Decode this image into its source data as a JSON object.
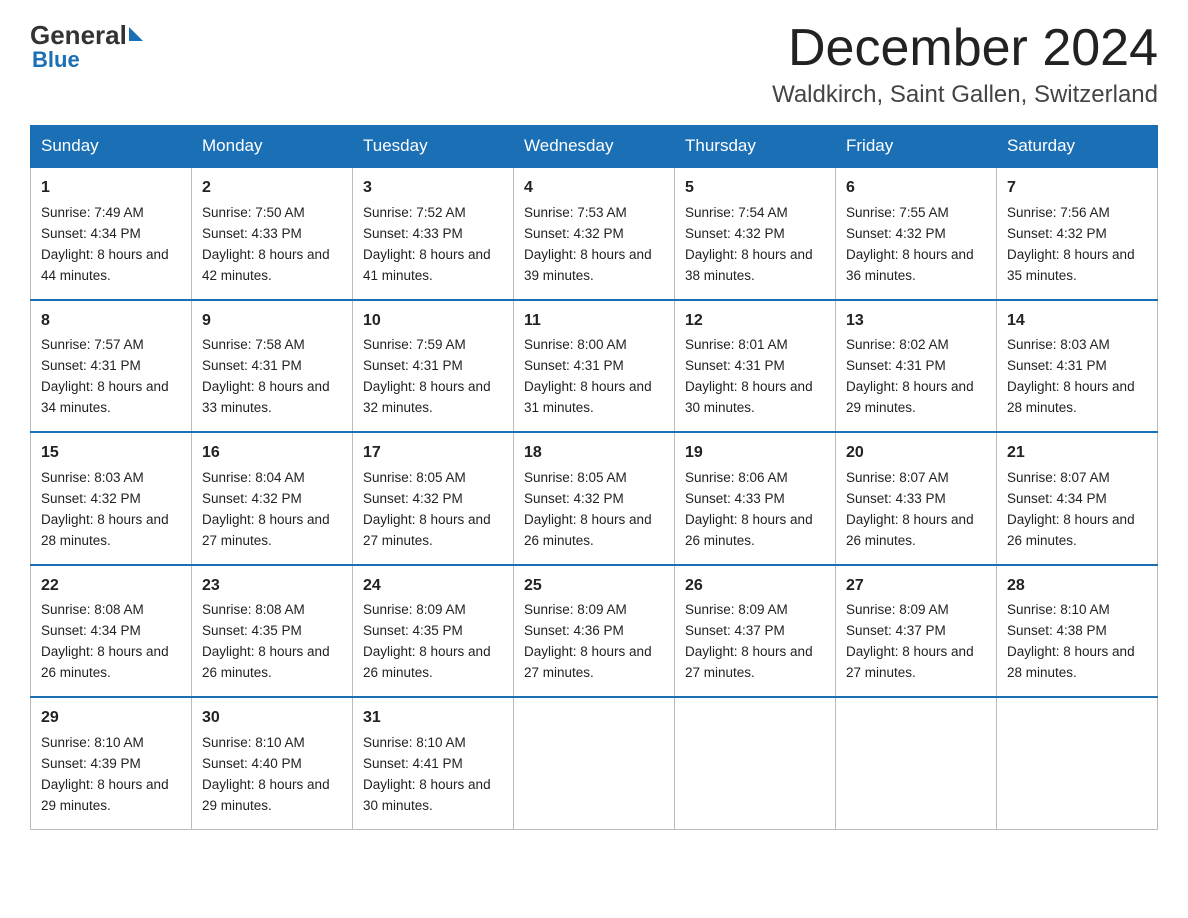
{
  "header": {
    "logo_general": "General",
    "logo_blue": "Blue",
    "month_title": "December 2024",
    "location": "Waldkirch, Saint Gallen, Switzerland"
  },
  "days_of_week": [
    "Sunday",
    "Monday",
    "Tuesday",
    "Wednesday",
    "Thursday",
    "Friday",
    "Saturday"
  ],
  "weeks": [
    [
      {
        "date": "1",
        "sunrise": "7:49 AM",
        "sunset": "4:34 PM",
        "daylight": "8 hours and 44 minutes."
      },
      {
        "date": "2",
        "sunrise": "7:50 AM",
        "sunset": "4:33 PM",
        "daylight": "8 hours and 42 minutes."
      },
      {
        "date": "3",
        "sunrise": "7:52 AM",
        "sunset": "4:33 PM",
        "daylight": "8 hours and 41 minutes."
      },
      {
        "date": "4",
        "sunrise": "7:53 AM",
        "sunset": "4:32 PM",
        "daylight": "8 hours and 39 minutes."
      },
      {
        "date": "5",
        "sunrise": "7:54 AM",
        "sunset": "4:32 PM",
        "daylight": "8 hours and 38 minutes."
      },
      {
        "date": "6",
        "sunrise": "7:55 AM",
        "sunset": "4:32 PM",
        "daylight": "8 hours and 36 minutes."
      },
      {
        "date": "7",
        "sunrise": "7:56 AM",
        "sunset": "4:32 PM",
        "daylight": "8 hours and 35 minutes."
      }
    ],
    [
      {
        "date": "8",
        "sunrise": "7:57 AM",
        "sunset": "4:31 PM",
        "daylight": "8 hours and 34 minutes."
      },
      {
        "date": "9",
        "sunrise": "7:58 AM",
        "sunset": "4:31 PM",
        "daylight": "8 hours and 33 minutes."
      },
      {
        "date": "10",
        "sunrise": "7:59 AM",
        "sunset": "4:31 PM",
        "daylight": "8 hours and 32 minutes."
      },
      {
        "date": "11",
        "sunrise": "8:00 AM",
        "sunset": "4:31 PM",
        "daylight": "8 hours and 31 minutes."
      },
      {
        "date": "12",
        "sunrise": "8:01 AM",
        "sunset": "4:31 PM",
        "daylight": "8 hours and 30 minutes."
      },
      {
        "date": "13",
        "sunrise": "8:02 AM",
        "sunset": "4:31 PM",
        "daylight": "8 hours and 29 minutes."
      },
      {
        "date": "14",
        "sunrise": "8:03 AM",
        "sunset": "4:31 PM",
        "daylight": "8 hours and 28 minutes."
      }
    ],
    [
      {
        "date": "15",
        "sunrise": "8:03 AM",
        "sunset": "4:32 PM",
        "daylight": "8 hours and 28 minutes."
      },
      {
        "date": "16",
        "sunrise": "8:04 AM",
        "sunset": "4:32 PM",
        "daylight": "8 hours and 27 minutes."
      },
      {
        "date": "17",
        "sunrise": "8:05 AM",
        "sunset": "4:32 PM",
        "daylight": "8 hours and 27 minutes."
      },
      {
        "date": "18",
        "sunrise": "8:05 AM",
        "sunset": "4:32 PM",
        "daylight": "8 hours and 26 minutes."
      },
      {
        "date": "19",
        "sunrise": "8:06 AM",
        "sunset": "4:33 PM",
        "daylight": "8 hours and 26 minutes."
      },
      {
        "date": "20",
        "sunrise": "8:07 AM",
        "sunset": "4:33 PM",
        "daylight": "8 hours and 26 minutes."
      },
      {
        "date": "21",
        "sunrise": "8:07 AM",
        "sunset": "4:34 PM",
        "daylight": "8 hours and 26 minutes."
      }
    ],
    [
      {
        "date": "22",
        "sunrise": "8:08 AM",
        "sunset": "4:34 PM",
        "daylight": "8 hours and 26 minutes."
      },
      {
        "date": "23",
        "sunrise": "8:08 AM",
        "sunset": "4:35 PM",
        "daylight": "8 hours and 26 minutes."
      },
      {
        "date": "24",
        "sunrise": "8:09 AM",
        "sunset": "4:35 PM",
        "daylight": "8 hours and 26 minutes."
      },
      {
        "date": "25",
        "sunrise": "8:09 AM",
        "sunset": "4:36 PM",
        "daylight": "8 hours and 27 minutes."
      },
      {
        "date": "26",
        "sunrise": "8:09 AM",
        "sunset": "4:37 PM",
        "daylight": "8 hours and 27 minutes."
      },
      {
        "date": "27",
        "sunrise": "8:09 AM",
        "sunset": "4:37 PM",
        "daylight": "8 hours and 27 minutes."
      },
      {
        "date": "28",
        "sunrise": "8:10 AM",
        "sunset": "4:38 PM",
        "daylight": "8 hours and 28 minutes."
      }
    ],
    [
      {
        "date": "29",
        "sunrise": "8:10 AM",
        "sunset": "4:39 PM",
        "daylight": "8 hours and 29 minutes."
      },
      {
        "date": "30",
        "sunrise": "8:10 AM",
        "sunset": "4:40 PM",
        "daylight": "8 hours and 29 minutes."
      },
      {
        "date": "31",
        "sunrise": "8:10 AM",
        "sunset": "4:41 PM",
        "daylight": "8 hours and 30 minutes."
      },
      null,
      null,
      null,
      null
    ]
  ],
  "labels": {
    "sunrise": "Sunrise:",
    "sunset": "Sunset:",
    "daylight": "Daylight:"
  }
}
